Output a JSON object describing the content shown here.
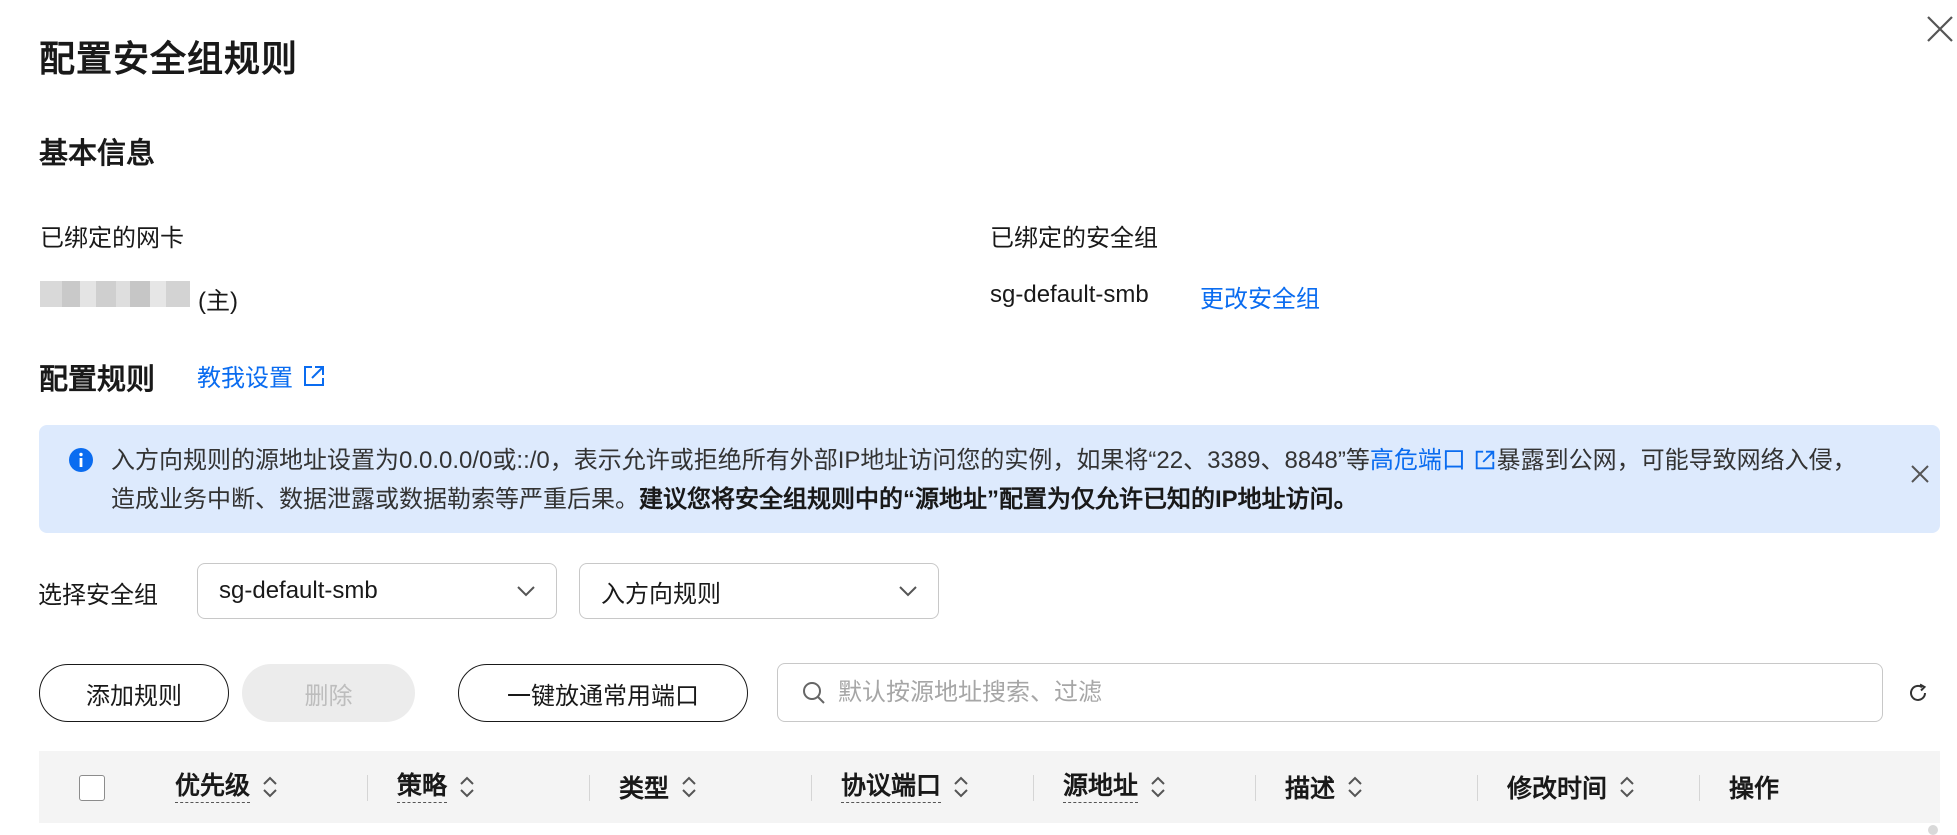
{
  "dialog": {
    "title": "配置安全组规则"
  },
  "basic": {
    "heading": "基本信息",
    "nic_label": "已绑定的网卡",
    "nic_suffix": "(主)",
    "sg_label": "已绑定的安全组",
    "sg_value": "sg-default-smb",
    "change_link": "更改安全组"
  },
  "rules": {
    "heading": "配置规则",
    "help_link": "教我设置"
  },
  "alert": {
    "part1": "入方向规则的源地址设置为0.0.0.0/0或::/0，表示允许或拒绝所有外部IP地址访问您的实例，如果将“22、3389、8848”等",
    "link": "高危端口",
    "part2": "暴露到公网，可能导致网络入侵，造成业务中断、数据泄露或数据勒索等严重后果。",
    "bold": "建议您将安全组规则中的“源地址”配置为仅允许已知的IP地址访问。"
  },
  "filters": {
    "label": "选择安全组",
    "sg_select": "sg-default-smb",
    "direction_select": "入方向规则"
  },
  "toolbar": {
    "add": "添加规则",
    "delete": "删除",
    "open_ports": "一键放通常用端口",
    "search_placeholder": "默认按源地址搜索、过滤"
  },
  "table": {
    "columns": [
      "优先级",
      "策略",
      "类型",
      "协议端口",
      "源地址",
      "描述",
      "修改时间",
      "操作"
    ]
  },
  "colors": {
    "link": "#0a6cf0",
    "alert_bg": "#ddeafd"
  }
}
